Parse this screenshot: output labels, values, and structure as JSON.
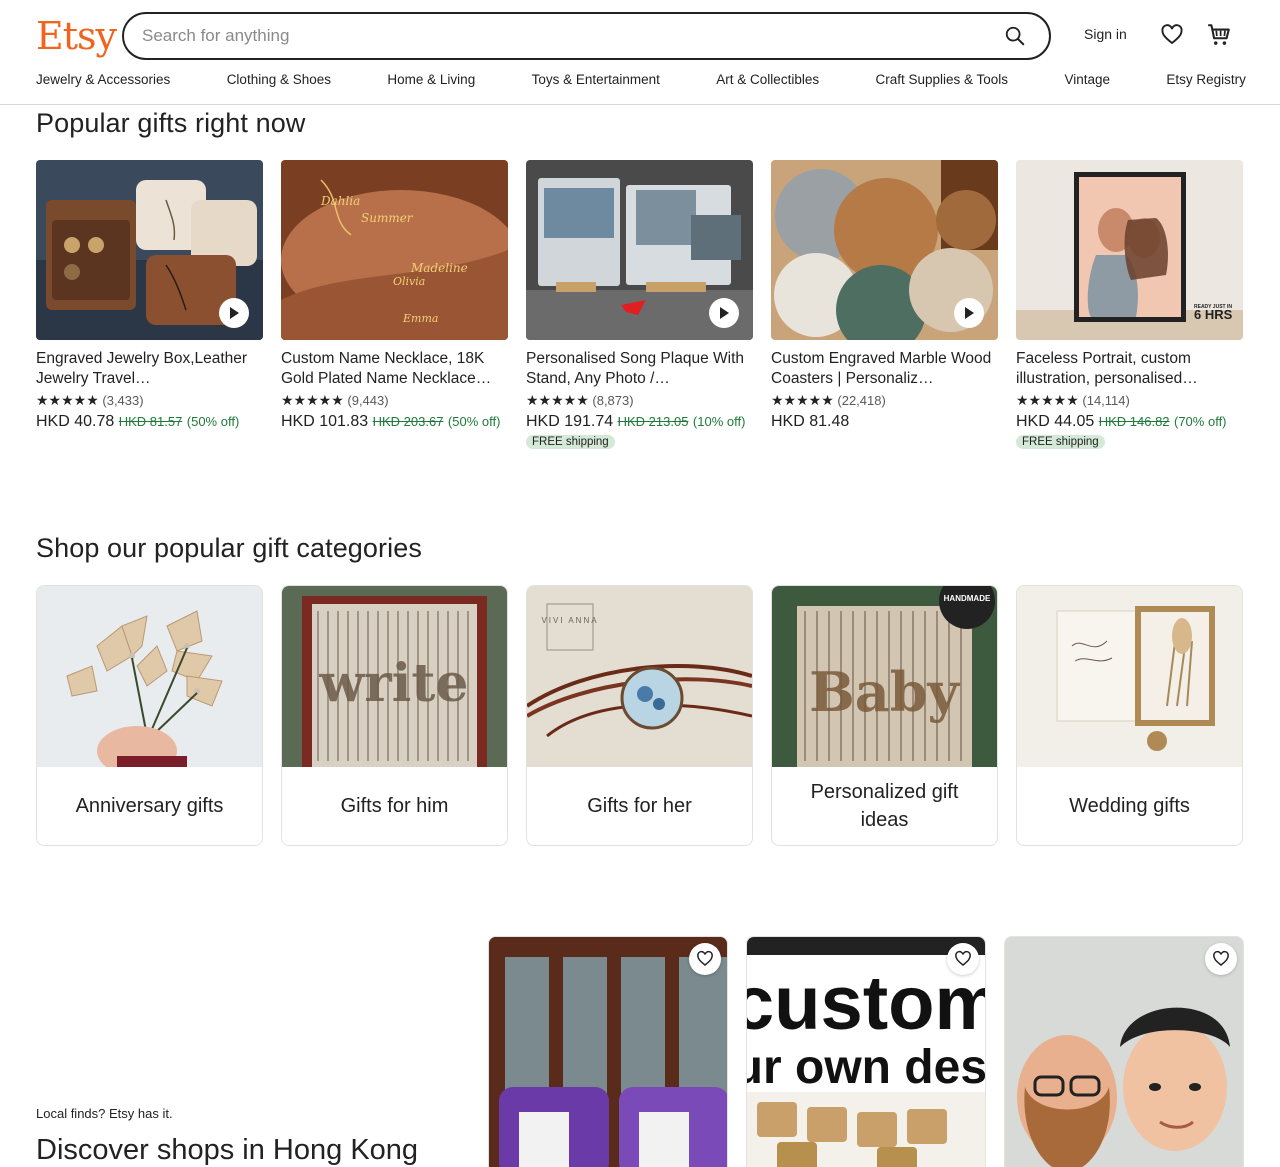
{
  "header": {
    "logo": "Etsy",
    "search_placeholder": "Search for anything",
    "search_value": "",
    "sign_in": "Sign in",
    "icons": {
      "search": "search-icon",
      "favorites": "heart-icon",
      "cart": "cart-icon"
    }
  },
  "nav": [
    "Jewelry & Accessories",
    "Clothing & Shoes",
    "Home & Living",
    "Toys & Entertainment",
    "Art & Collectibles",
    "Craft Supplies & Tools",
    "Vintage",
    "Etsy Registry"
  ],
  "popular": {
    "title": "Popular gifts right now",
    "items": [
      {
        "title": "Engraved Jewelry Box,Leather Jewelry Travel…",
        "stars": "★★★★★",
        "reviews": "(3,433)",
        "price": "HKD 40.78",
        "original": "HKD 81.57",
        "discount": "(50% off)",
        "badge": "",
        "video": true
      },
      {
        "title": "Custom Name Necklace, 18K Gold Plated Name Necklace…",
        "stars": "★★★★★",
        "reviews": "(9,443)",
        "price": "HKD 101.83",
        "original": "HKD 203.67",
        "discount": "(50% off)",
        "badge": "",
        "video": false
      },
      {
        "title": "Personalised Song Plaque With Stand, Any Photo /…",
        "stars": "★★★★★",
        "reviews": "(8,873)",
        "price": "HKD 191.74",
        "original": "HKD 213.05",
        "discount": "(10% off)",
        "badge": "FREE shipping",
        "video": true
      },
      {
        "title": "Custom Engraved Marble Wood Coasters | Personaliz…",
        "stars": "★★★★★",
        "reviews": "(22,418)",
        "price": "HKD 81.48",
        "original": "",
        "discount": "",
        "badge": "",
        "video": true
      },
      {
        "title": "Faceless Portrait, custom illustration, personalised…",
        "stars": "★★★★★",
        "reviews": "(14,114)",
        "price": "HKD 44.05",
        "original": "HKD 146.82",
        "discount": "(70% off)",
        "badge": "FREE shipping",
        "video": false
      }
    ]
  },
  "categories": {
    "title": "Shop our popular gift categories",
    "items": [
      {
        "label": "Anniversary gifts"
      },
      {
        "label": "Gifts for him"
      },
      {
        "label": "Gifts for her",
        "brand": "VIVI ANNA"
      },
      {
        "label": "Personalized gift ideas",
        "stamp": "HANDMADE"
      },
      {
        "label": "Wedding gifts"
      }
    ]
  },
  "local": {
    "kicker": "Local finds? Etsy has it.",
    "title": "Discover shops in Hong Kong",
    "shops": [
      {
        "name": "shop-candles"
      },
      {
        "name": "shop-custom-design",
        "text1": "custom",
        "text2": "ur own desi"
      },
      {
        "name": "shop-figurines"
      }
    ]
  },
  "colors": {
    "brand": "#F1641E",
    "discount": "#1f7a3b",
    "badge_bg": "#d4e9d7"
  }
}
